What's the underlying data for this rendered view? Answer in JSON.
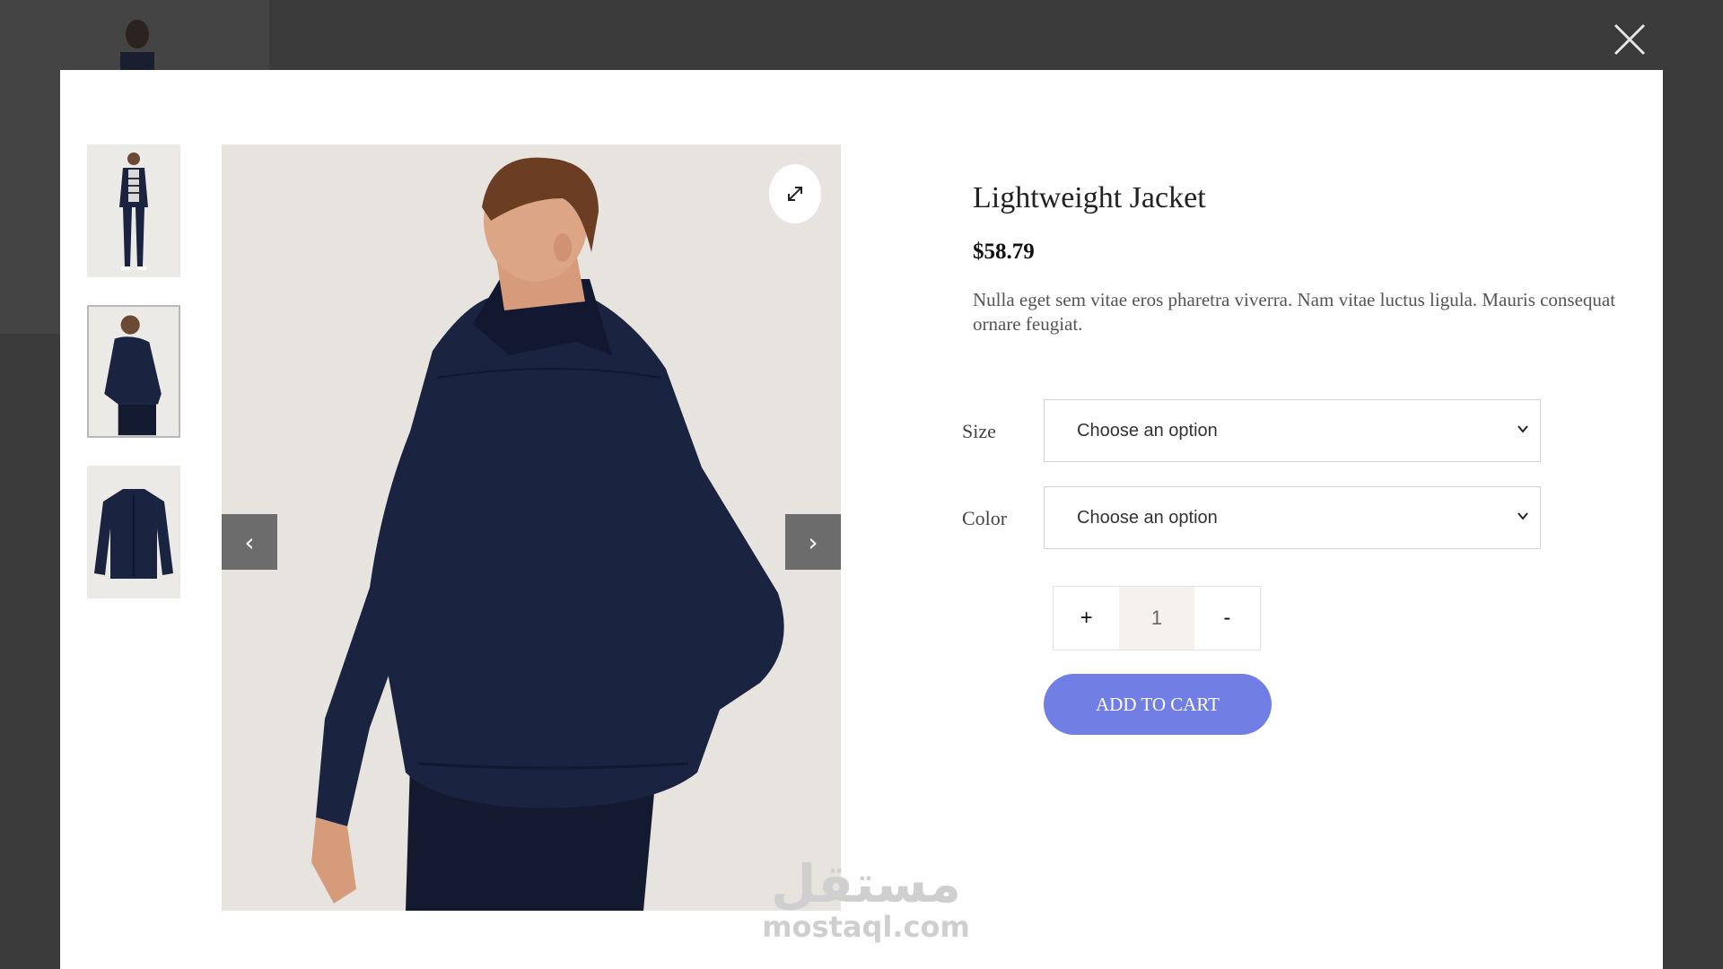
{
  "product": {
    "title": "Lightweight Jacket",
    "price": "$58.79",
    "description": "Nulla eget sem vitae eros pharetra viverra. Nam vitae luctus ligula. Mauris consequat ornare feugiat."
  },
  "options": {
    "size_label": "Size",
    "size_value": "Choose an option",
    "color_label": "Color",
    "color_value": "Choose an option"
  },
  "quantity": {
    "plus": "+",
    "value": "1",
    "minus": "-"
  },
  "add_to_cart_label": "ADD TO CART",
  "gallery": {
    "prev": "‹",
    "next": "›",
    "thumbnails": [
      "model-front",
      "model-back",
      "jacket-flat"
    ],
    "active_index": 1
  },
  "watermark": {
    "arabic": "مستقل",
    "latin": "mostaql.com"
  },
  "colors": {
    "overlay": "#3b3b3b",
    "accent": "#717ee3",
    "jacket": "#1a2340"
  }
}
